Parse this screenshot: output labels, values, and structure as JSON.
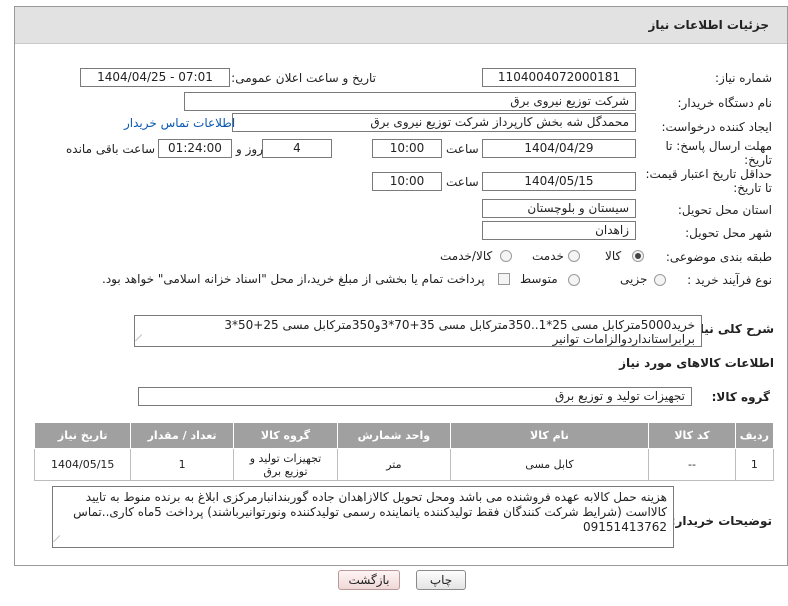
{
  "header": {
    "title": "جزئیات اطلاعات نیاز"
  },
  "fields": {
    "need_number": {
      "label": "شماره نیاز:",
      "value": "1104004072000181"
    },
    "announce_datetime": {
      "label": "تاریخ و ساعت اعلان عمومی:",
      "value": "1404/04/25 - 07:01"
    },
    "buyer_org": {
      "label": "نام دستگاه خریدار:",
      "value": "شرکت توزیع نیروی برق"
    },
    "requester": {
      "label": "ایجاد کننده درخواست:",
      "value": "محمدگل شه بخش کارپرداز شرکت توزیع نیروی برق",
      "contact_link": "اطلاعات تماس خریدار"
    },
    "deadline": {
      "label_line1": "مهلت ارسال پاسخ: تا",
      "label_line2": "تاریخ:",
      "date": "1404/04/29",
      "time_label": "ساعت",
      "time": "10:00",
      "days": "4",
      "days_label": "روز و",
      "remaining": "01:24:00",
      "remaining_label": "ساعت باقی مانده"
    },
    "price_validity": {
      "label_line1": "حداقل تاریخ اعتبار قیمت:",
      "label_line2": "تا تاریخ:",
      "date": "1404/05/15",
      "time_label": "ساعت",
      "time": "10:00"
    },
    "province": {
      "label": "استان محل تحویل:",
      "value": "سیستان و بلوچستان"
    },
    "city": {
      "label": "شهر محل تحویل:",
      "value": "زاهدان"
    },
    "category": {
      "label": "طبقه بندی موضوعی:",
      "options": [
        "کالا",
        "خدمت",
        "کالا/خدمت"
      ],
      "selected": "کالا"
    },
    "purchase_type": {
      "label": "نوع فرآیند خرید :",
      "options": [
        "جزیی",
        "متوسط"
      ],
      "selected": "",
      "payment_note": "پرداخت تمام یا بخشی از مبلغ خرید،از محل \"اسناد خزانه اسلامی\" خواهد بود."
    },
    "description": {
      "label": "شرح کلی نیاز:",
      "line1": "خرید5000مترکابل مسی 25*1..350مترکابل مسی 35+70*3و350مترکابل مسی 25+50*3",
      "line2": "برابراستانداردوالزامات توانیر"
    }
  },
  "goods_section": {
    "title": "اطلاعات کالاهای مورد نیاز",
    "group_label": "گروه کالا:",
    "group_value": "تجهیزات تولید و توزیع برق"
  },
  "table": {
    "headers": [
      "ردیف",
      "کد کالا",
      "نام کالا",
      "واحد شمارش",
      "گروه کالا",
      "تعداد / مقدار",
      "تاریخ نیاز"
    ],
    "rows": [
      {
        "row": "1",
        "code": "--",
        "name": "کابل مسی",
        "unit": "متر",
        "group": "تجهیزات تولید و توزیع برق",
        "qty": "1",
        "date": "1404/05/15"
      }
    ]
  },
  "buyer_notes": {
    "label": "توضیحات خریدار:",
    "line1": "هزینه حمل کالابه عهده فروشنده می باشد ومحل تحویل کالازاهدان جاده گوربندانبارمرکزی  ابلاغ به برنده منوط به تایید",
    "line2": "کالااست (شرایط شرکت کنندگان فقط تولیدکننده یانماینده رسمی تولیدکننده ونورتوانیرباشند) پرداخت 5ماه کاری..تماس",
    "line3": "09151413762"
  },
  "buttons": {
    "print": "چاپ",
    "back": "بازگشت"
  },
  "colors": {
    "header_bg": "#e2e2e2",
    "table_header_bg": "#a0a0a0",
    "link": "#0a58b0"
  }
}
